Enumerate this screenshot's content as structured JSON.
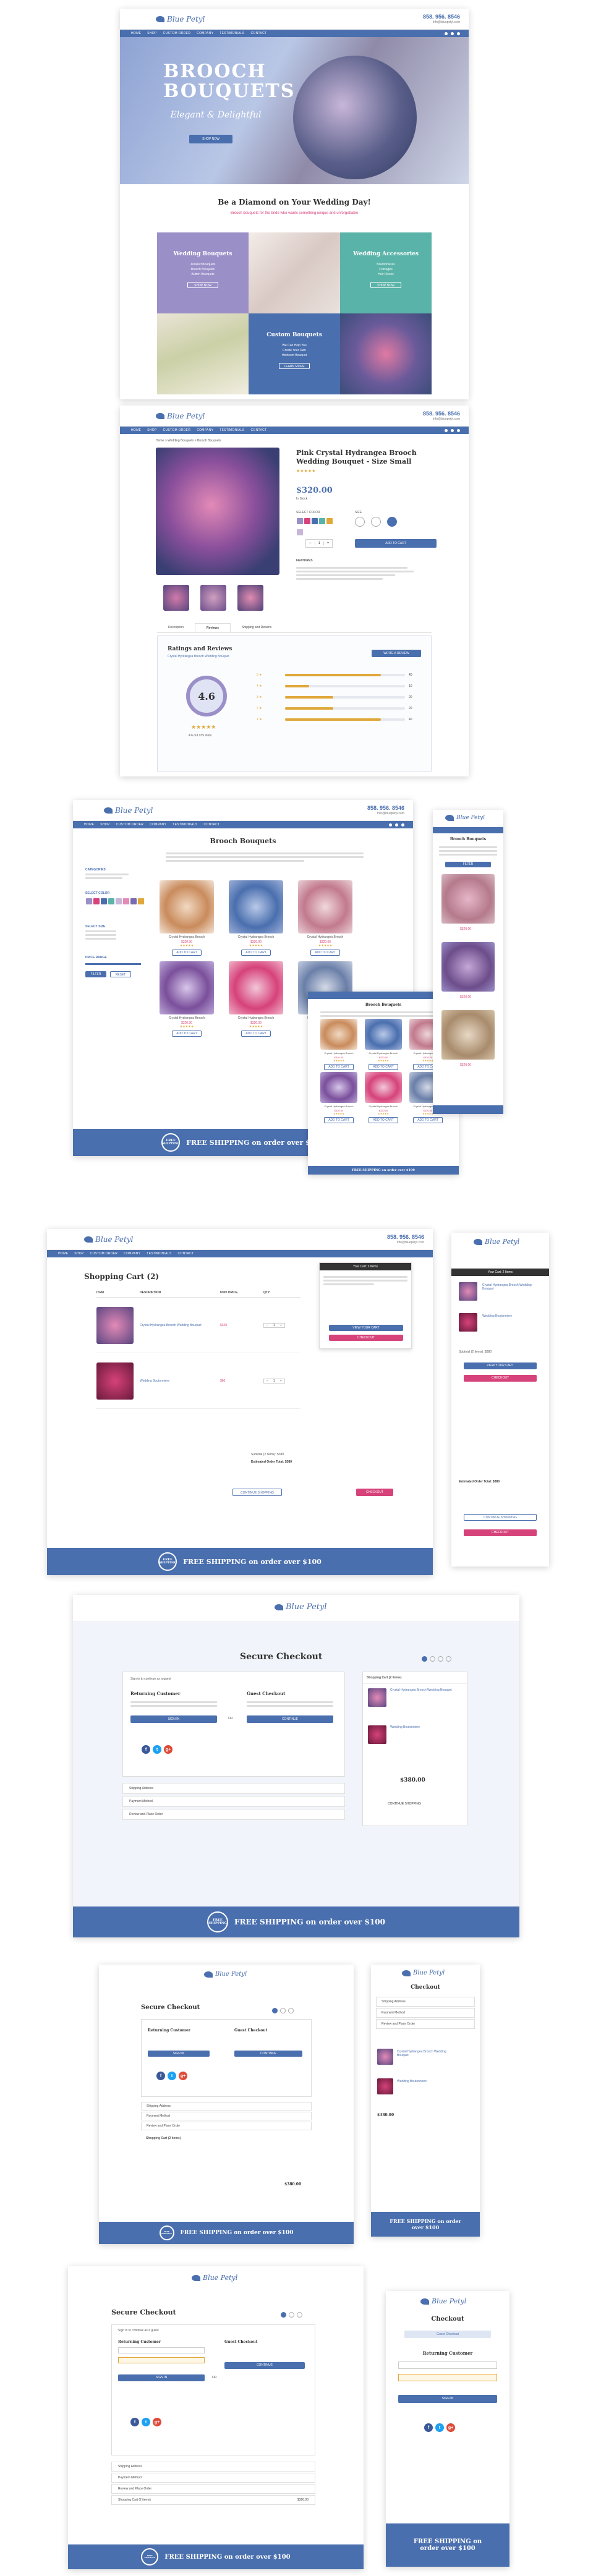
{
  "brand": {
    "name": "Blue Petyl",
    "phone": "858. 956. 8546",
    "email": "Info@bluepetyl.com"
  },
  "nav": [
    "HOME",
    "SHOP",
    "CUSTOM ORDER",
    "COMPANY",
    "TESTIMONIALS",
    "CONTACT"
  ],
  "home": {
    "hero_title": "BROOCH BOUQUETS",
    "hero_sub": "Elegant & Delightful",
    "hero_btn": "SHOP NOW",
    "diamond": "Be a Diamond on Your Wedding Day!",
    "diamond_sub": "Brooch bouquets for the bride who wants something unique and unforgettable",
    "tiles": [
      {
        "title": "Wedding Bouquets",
        "lines": [
          "Jeweled Bouquets",
          "Brooch Bouquets",
          "Button Bouquets"
        ],
        "btn": "SHOP NOW"
      },
      {
        "title": "Wedding Accessories",
        "lines": [
          "Boutonnieres",
          "Corsages",
          "Hair Pieces"
        ],
        "btn": "SHOP NOW"
      },
      {
        "title": "Custom Bouquets",
        "lines": [
          "We Can Help You",
          "Create Your Own",
          "Heirloom Bouquet"
        ],
        "btn": "LEARN MORE"
      }
    ]
  },
  "product": {
    "breadcrumb": "Home > Wedding Bouquets > Brooch Bouquets",
    "title": "Pink Crystal Hydrangea Brooch Wedding Bouquet - Size Small",
    "price": "$320.00",
    "stock": "In Stock",
    "color_label": "SELECT COLOR",
    "size_label": "SIZE",
    "qty": "1",
    "add_btn": "ADD TO CART",
    "features_label": "FEATURES",
    "tabs": [
      "Description",
      "Reviews",
      "Shipping and Returns"
    ],
    "reviews_title": "Ratings and Reviews",
    "reviews_sub": "Crystal Hydrangea Brooch Wedding Bouquet",
    "write_btn": "WRITE A REVIEW",
    "rating": "4.6",
    "rating_caption": "4.6 out of 5 stars",
    "bars": [
      {
        "label": "5",
        "pct": 0.8,
        "count": "40"
      },
      {
        "label": "4",
        "pct": 0.2,
        "count": "10"
      },
      {
        "label": "3",
        "pct": 0.4,
        "count": "20"
      },
      {
        "label": "2",
        "pct": 0.4,
        "count": "20"
      },
      {
        "label": "1",
        "pct": 0.8,
        "count": "40"
      }
    ]
  },
  "category": {
    "title": "Brooch Bouquets",
    "sort": "Sort by",
    "filters": [
      "CATEGORIES",
      "SELECT COLOR",
      "SELECT SIZE",
      "PRICE RANGE"
    ],
    "btns": [
      "FILTER",
      "RESET"
    ],
    "items": [
      {
        "name": "Crystal Hydrangea Brooch",
        "price": "$320.00"
      },
      {
        "name": "Crystal Hydrangea Brooch",
        "price": "$320.00"
      },
      {
        "name": "Crystal Hydrangea Brooch",
        "price": "$320.00"
      },
      {
        "name": "Crystal Hydrangea Brooch",
        "price": "$320.00"
      },
      {
        "name": "Crystal Hydrangea Brooch",
        "price": "$320.00"
      },
      {
        "name": "Crystal Hydrangea Brooch",
        "price": "$320.00"
      }
    ],
    "add": "ADD TO CART"
  },
  "cart": {
    "title": "Shopping Cart (2)",
    "headers": [
      "ITEM",
      "DESCRIPTION",
      "UNIT PRICE",
      "QTY"
    ],
    "items": [
      {
        "desc": "Crystal Hydrangea Brooch Wedding Bouquet",
        "price": "$320",
        "qty": "1"
      },
      {
        "desc": "Wedding Boutonniere",
        "price": "$60",
        "qty": "1"
      }
    ],
    "subtotal": "Subtotal (2 items): $380",
    "estimated": "Estimated Order Total: $380",
    "continue": "CONTINUE SHOPPING",
    "checkout": "CHECKOUT",
    "view_cart": "VIEW YOUR CART",
    "mini_title": "Your Cart: 2 Items"
  },
  "checkout": {
    "title": "Secure Checkout",
    "mobile_title": "Checkout",
    "signin_prompt": "Sign in to continue as a guest",
    "returning": "Returning Customer",
    "guest": "Guest Checkout",
    "signin_btn": "SIGN IN",
    "continue_btn": "CONTINUE",
    "or": "OR",
    "sections": [
      "Shipping Address",
      "Payment Method",
      "Review and Place Order"
    ],
    "cart_label": "Shopping Cart (2 items)",
    "total": "$380.00",
    "continue_shopping": "CONTINUE SHOPPING",
    "social": [
      "f",
      "t",
      "g+"
    ]
  },
  "shipping_banner": "FREE SHIPPING on order over $100",
  "badge": "FREE SHIPPING",
  "colors": {
    "accent": "#4a6fae",
    "pink": "#d6427a",
    "teal": "#5ab3a8",
    "lavender": "#9b8fc8",
    "gold": "#e0a83a"
  }
}
